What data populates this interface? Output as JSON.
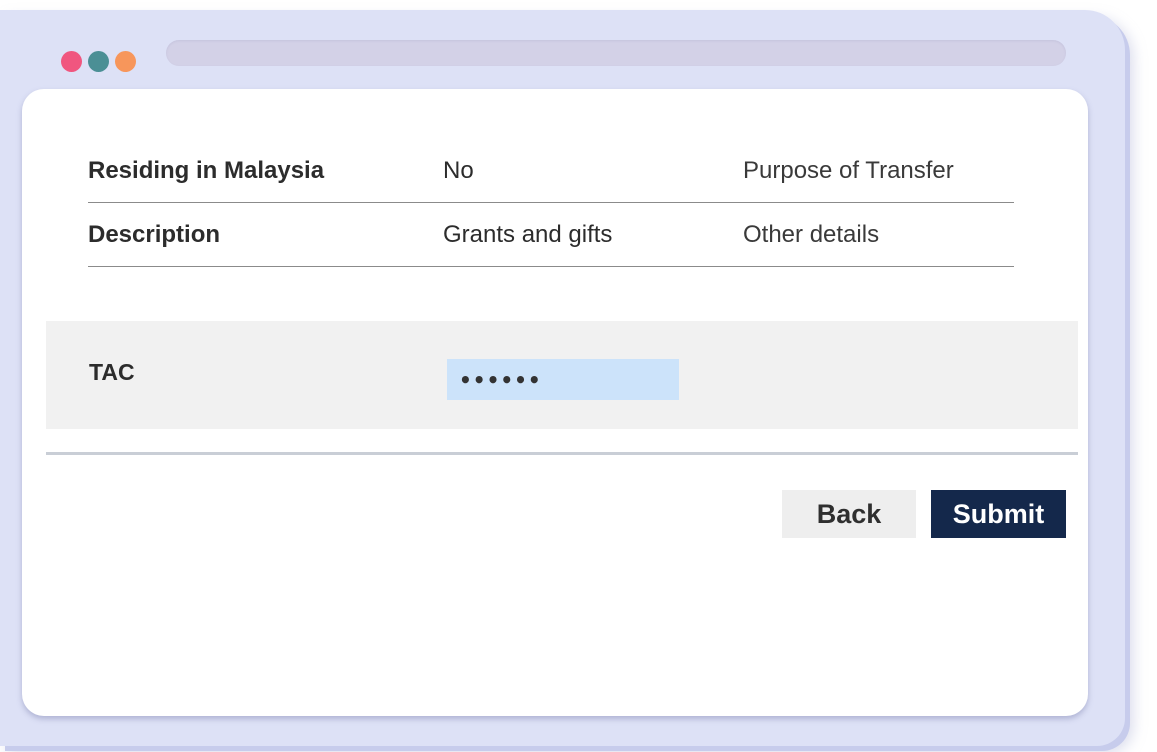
{
  "window": {
    "controls": [
      {
        "name": "close",
        "color": "#f0567f"
      },
      {
        "name": "minimize",
        "color": "#4b8f95"
      },
      {
        "name": "maximize",
        "color": "#f7965b"
      }
    ],
    "frame_color": "#dde1f6"
  },
  "details": {
    "rows": [
      {
        "label": "Residing in Malaysia",
        "value": "No",
        "extra": "Purpose of Transfer"
      },
      {
        "label": "Description",
        "value": "Grants and gifts",
        "extra": "Other details"
      }
    ]
  },
  "tac": {
    "label": "TAC",
    "value": "••••••",
    "input_color": "#cce3fa"
  },
  "actions": {
    "back_label": "Back",
    "submit_label": "Submit",
    "submit_color": "#14284b"
  }
}
